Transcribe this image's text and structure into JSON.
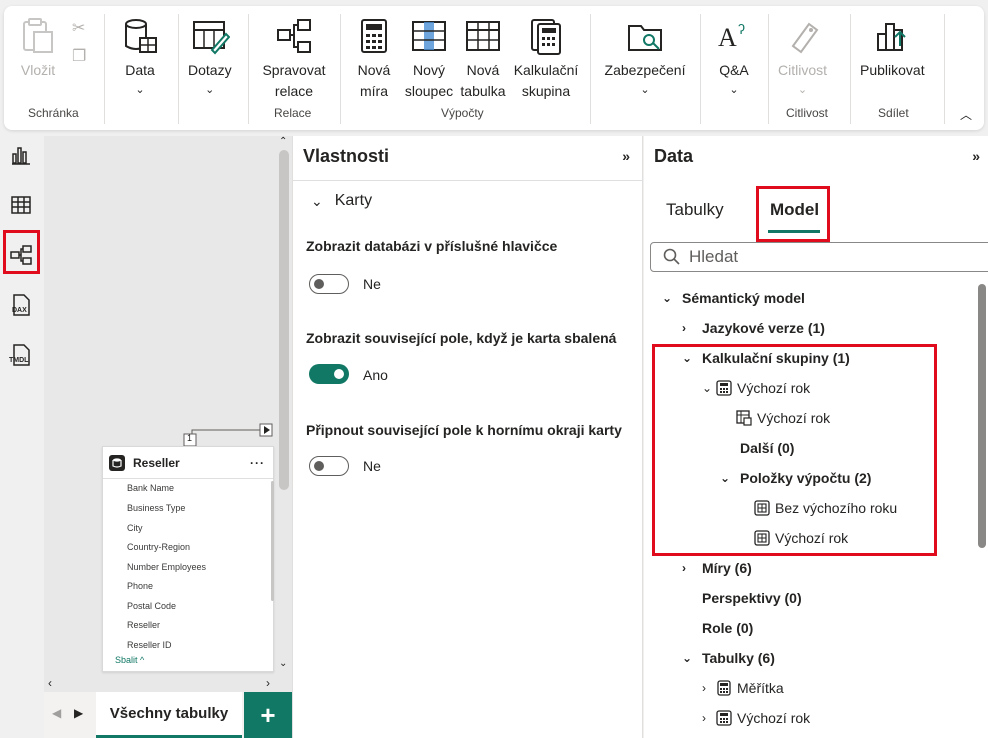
{
  "ribbon": {
    "groups": [
      {
        "label": "Schránka"
      },
      {
        "label": "Relace"
      },
      {
        "label": "Výpočty"
      },
      {
        "label": "Citlivost"
      },
      {
        "label": "Sdílet"
      }
    ],
    "paste_label": "Vložit",
    "data_label": "Data",
    "queries_label": "Dotazy",
    "manage_rel_label": "Spravovat relace",
    "new_measure_label": "Nová míra",
    "new_column_label": "Nový sloupec",
    "new_table_label": "Nová tabulka",
    "calc_group_label": "Kalkulační skupina",
    "security_label": "Zabezpečení",
    "qa_label": "Q&A",
    "sensitivity_label": "Citlivost",
    "publish_label": "Publikovat"
  },
  "canvas": {
    "table_card": {
      "title": "Reseller",
      "more": "···",
      "fields": [
        "Bank Name",
        "Business Type",
        "City",
        "Country-Region",
        "Number Employees",
        "Phone",
        "Postal Code",
        "Reseller",
        "Reseller ID"
      ],
      "collapse_label": "Sbalit ^"
    },
    "relationship_badge": "1",
    "page_tab": "Všechny tabulky",
    "add_page": "+"
  },
  "properties": {
    "title": "Vlastnosti",
    "expand": "»",
    "section": "Karty",
    "items": [
      {
        "label": "Zobrazit databázi v příslušné hlavičce",
        "value": "Ne",
        "on": false
      },
      {
        "label": "Zobrazit související pole, když je karta sbalená",
        "value": "Ano",
        "on": true
      },
      {
        "label": "Připnout související pole k hornímu okraji karty",
        "value": "Ne",
        "on": false
      }
    ]
  },
  "data_pane": {
    "title": "Data",
    "expand": "»",
    "tabs": [
      "Tabulky",
      "Model"
    ],
    "active_tab": "Model",
    "search_placeholder": "Hledat",
    "tree": [
      {
        "label": "Sémantický model",
        "bold": true
      },
      {
        "label": "Jazykové verze (1)",
        "bold": true
      },
      {
        "label": "Kalkulační skupiny (1)",
        "bold": true
      },
      {
        "label": "Výchozí rok",
        "bold": false
      },
      {
        "label": "Výchozí rok",
        "bold": false
      },
      {
        "label": "Další (0)",
        "bold": true
      },
      {
        "label": "Položky výpočtu (2)",
        "bold": true
      },
      {
        "label": "Bez výchozího roku",
        "bold": false
      },
      {
        "label": "Výchozí rok",
        "bold": false
      },
      {
        "label": "Míry (6)",
        "bold": true
      },
      {
        "label": "Perspektivy (0)",
        "bold": true
      },
      {
        "label": "Role (0)",
        "bold": true
      },
      {
        "label": "Tabulky (6)",
        "bold": true
      },
      {
        "label": "Měřítka",
        "bold": false
      },
      {
        "label": "Výchozí rok",
        "bold": false
      }
    ]
  },
  "colors": {
    "accent": "#117865",
    "highlight": "#e00b1c"
  }
}
